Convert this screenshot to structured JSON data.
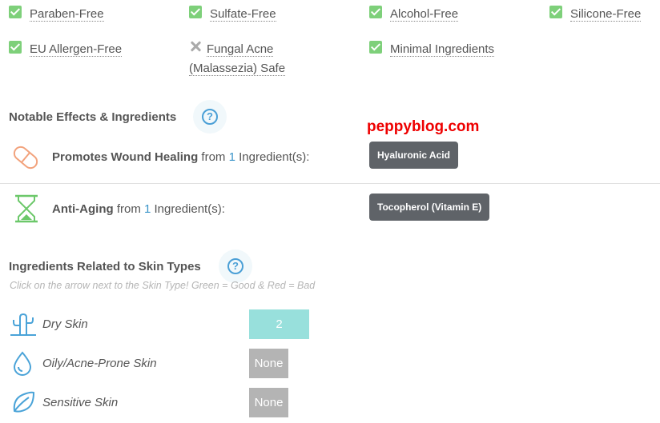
{
  "free_from": [
    {
      "label": "Paraben-Free",
      "status": "yes"
    },
    {
      "label": "Sulfate-Free",
      "status": "yes"
    },
    {
      "label": "Alcohol-Free",
      "status": "yes"
    },
    {
      "label": "Silicone-Free",
      "status": "yes"
    },
    {
      "label": "EU Allergen-Free",
      "status": "yes"
    },
    {
      "label_line1": "Fungal Acne",
      "label_line2": "(Malassezia) Safe",
      "status": "no"
    },
    {
      "label": "Minimal Ingredients",
      "status": "yes"
    }
  ],
  "notable": {
    "title": "Notable Effects & Ingredients",
    "help_glyph": "?",
    "effects": [
      {
        "name": "Promotes Wound Healing",
        "from_text": "from",
        "count": "1",
        "suffix": "Ingredient(s):",
        "ingredient": "Hyaluronic Acid",
        "icon": "bandage-icon"
      },
      {
        "name": "Anti-Aging",
        "from_text": "from",
        "count": "1",
        "suffix": "Ingredient(s):",
        "ingredient": "Tocopherol (Vitamin E)",
        "icon": "hourglass-icon"
      }
    ]
  },
  "watermark": "peppyblog.com",
  "skin_types": {
    "title": "Ingredients Related to Skin Types",
    "help_glyph": "?",
    "note": "Click on the arrow next to the Skin Type! Green = Good & Red = Bad",
    "rows": [
      {
        "label": "Dry Skin",
        "value": "2",
        "state": "good",
        "icon": "cactus-icon"
      },
      {
        "label": "Oily/Acne-Prone Skin",
        "value": "None",
        "state": "none",
        "icon": "oil-drop-icon"
      },
      {
        "label": "Sensitive Skin",
        "value": "None",
        "state": "none",
        "icon": "leaf-icon"
      }
    ]
  },
  "colors": {
    "check_green": "#7ed07a",
    "link_blue": "#3b95c9",
    "tag_gray": "#5f6368",
    "good_teal": "#98e0dc",
    "none_gray": "#b4b4b4",
    "icon_blue": "#4aa3d8",
    "bandage_orange": "#f2a27c",
    "hourglass_green": "#6cc86a",
    "watermark_red": "#ee0000"
  }
}
